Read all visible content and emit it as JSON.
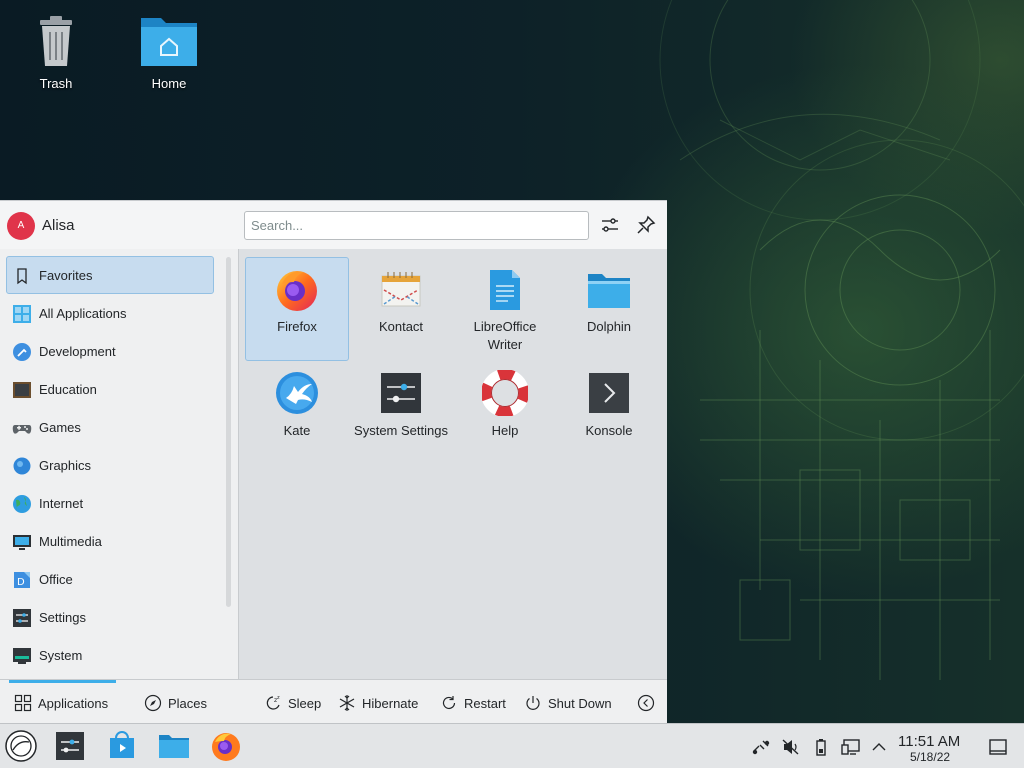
{
  "desktop": {
    "icons": [
      {
        "label": "Trash"
      },
      {
        "label": "Home"
      }
    ]
  },
  "launcher": {
    "user": {
      "initial": "A",
      "name": "Alisa"
    },
    "search": {
      "placeholder": "Search..."
    },
    "categories": [
      {
        "label": "Favorites",
        "icon": "bookmark-icon",
        "active": true
      },
      {
        "label": "All Applications",
        "icon": "grid-apps-icon"
      },
      {
        "label": "Development",
        "icon": "development-icon"
      },
      {
        "label": "Education",
        "icon": "education-icon"
      },
      {
        "label": "Games",
        "icon": "gamepad-icon"
      },
      {
        "label": "Graphics",
        "icon": "graphics-icon"
      },
      {
        "label": "Internet",
        "icon": "globe-icon"
      },
      {
        "label": "Multimedia",
        "icon": "multimedia-icon"
      },
      {
        "label": "Office",
        "icon": "office-icon"
      },
      {
        "label": "Settings",
        "icon": "settings-icon"
      },
      {
        "label": "System",
        "icon": "system-icon"
      }
    ],
    "favorites": [
      {
        "label": "Firefox",
        "icon": "firefox-icon",
        "active": true
      },
      {
        "label": "Kontact",
        "icon": "kontact-icon"
      },
      {
        "label": "LibreOffice Writer",
        "icon": "libreoffice-writer-icon"
      },
      {
        "label": "Dolphin",
        "icon": "dolphin-folder-icon"
      },
      {
        "label": "Kate",
        "icon": "kate-icon"
      },
      {
        "label": "System Settings",
        "icon": "system-settings-icon"
      },
      {
        "label": "Help",
        "icon": "help-lifebuoy-icon"
      },
      {
        "label": "Konsole",
        "icon": "konsole-icon"
      }
    ],
    "footer": {
      "applications": "Applications",
      "places": "Places",
      "sleep": "Sleep",
      "hibernate": "Hibernate",
      "restart": "Restart",
      "shutdown": "Shut Down"
    }
  },
  "taskbar": {
    "clock_time": "11:51 AM",
    "clock_date": "5/18/22"
  },
  "colors": {
    "accent": "#3daee9",
    "selection": "#c7dcef",
    "panel": "#eff0f1"
  }
}
